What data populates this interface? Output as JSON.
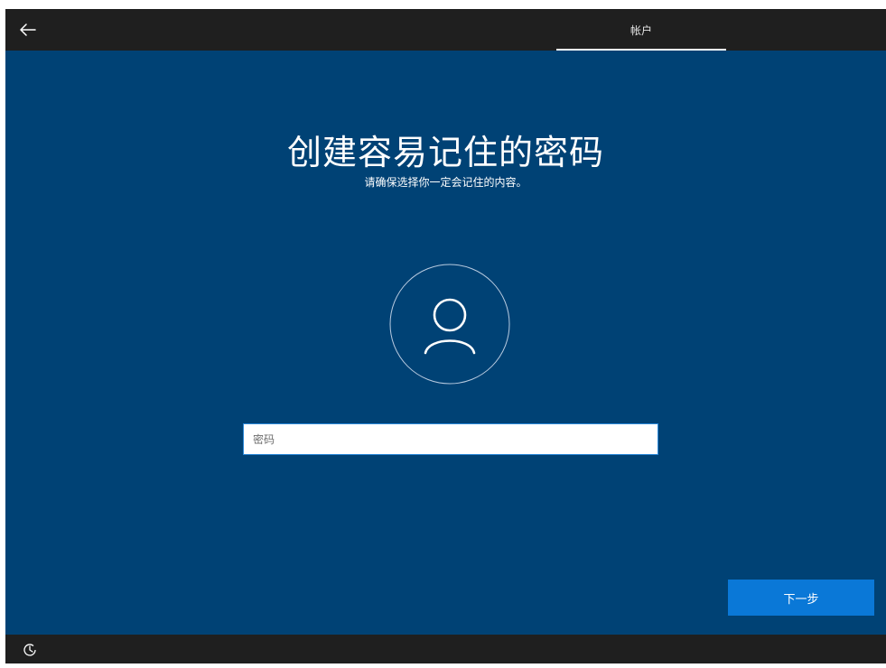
{
  "header": {
    "back_icon": "arrow-left-icon",
    "tab_label": "帐户"
  },
  "main": {
    "title": "创建容易记住的密码",
    "subtitle": "请确保选择你一定会记住的内容。",
    "avatar_icon": "user-icon",
    "password": {
      "value": "",
      "placeholder": "密码"
    },
    "next_label": "下一步"
  },
  "footer": {
    "accessibility_icon": "accessibility-icon"
  },
  "colors": {
    "background": "#004275",
    "bar": "#1f1f1f",
    "accent": "#0a78d7"
  }
}
